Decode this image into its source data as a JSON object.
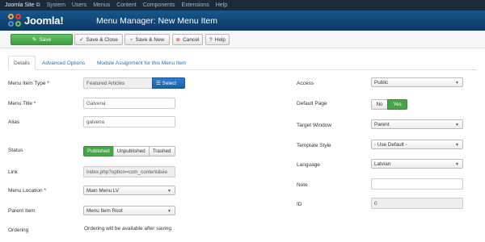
{
  "topbar": {
    "site": "Joomla Site",
    "ext_icon": "external-link-icon",
    "menus": [
      "System",
      "Users",
      "Menus",
      "Content",
      "Components",
      "Extensions",
      "Help"
    ]
  },
  "header": {
    "logo": "Joomla!",
    "title": "Menu Manager: New Menu Item"
  },
  "toolbar": {
    "save": "Save",
    "save_close": "Save & Close",
    "save_new": "Save & New",
    "cancel": "Cancel",
    "help": "Help"
  },
  "tabs": [
    "Details",
    "Advanced Options",
    "Module Assignment for this Menu Item"
  ],
  "left": {
    "menu_item_type": {
      "label": "Menu Item Type *",
      "value": "Featured Articles",
      "button": "Select"
    },
    "menu_title": {
      "label": "Menu Title *",
      "value": "Galvena"
    },
    "alias": {
      "label": "Alias",
      "value": "galvena"
    },
    "status": {
      "label": "Status",
      "options": [
        "Published",
        "Unpublished",
        "Trashed"
      ],
      "selected": "Published"
    },
    "link": {
      "label": "Link",
      "value": "index.php?option=com_content&vie"
    },
    "menu_location": {
      "label": "Menu Location *",
      "value": "Main Menu LV"
    },
    "parent_item": {
      "label": "Parent Item",
      "value": "Menu Item Root"
    },
    "ordering": {
      "label": "Ordering",
      "value": "Ordering will be available after saving"
    }
  },
  "right": {
    "access": {
      "label": "Access",
      "value": "Public"
    },
    "default_page": {
      "label": "Default Page",
      "options": [
        "No",
        "Yes"
      ],
      "selected": "Yes"
    },
    "target_window": {
      "label": "Target Window",
      "value": "Parent"
    },
    "template_style": {
      "label": "Template Style",
      "value": "- Use Default -"
    },
    "language": {
      "label": "Language",
      "value": "Latvian"
    },
    "note": {
      "label": "Note",
      "value": ""
    },
    "id": {
      "label": "ID",
      "value": "0"
    }
  },
  "colors": {
    "topbar": "#1c2a3c",
    "header": "#17568c",
    "save_green": "#46a546",
    "select_blue": "#2a7fd4",
    "link_blue": "#1f6fb5"
  }
}
